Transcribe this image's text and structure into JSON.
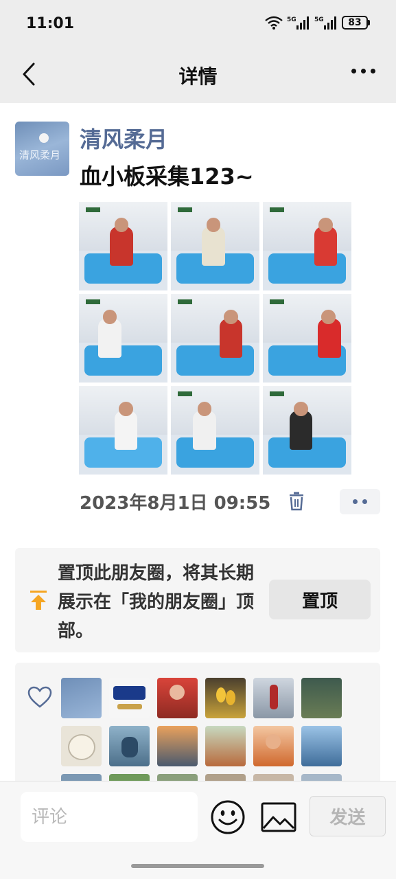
{
  "status_bar": {
    "time": "11:01",
    "signal_1_label": "5G",
    "signal_2_label": "5G",
    "battery": "83",
    "icons": [
      "wifi-icon",
      "signal-icon",
      "signal-icon",
      "battery-icon"
    ]
  },
  "nav": {
    "title": "详情",
    "back_icon": "back-chevron-icon",
    "more_icon": "more-dots-icon"
  },
  "post": {
    "username": "清风柔月",
    "avatar_label": "清风柔月",
    "text": "血小板采集123~",
    "time": "2023年8月1日 09:55",
    "photo_count": 9,
    "delete_icon": "trash-icon",
    "more_icon": "more-dots-icon"
  },
  "pin_card": {
    "text": "置顶此朋友圈，将其长期展示在「我的朋友圈」顶部。",
    "button_label": "置顶",
    "icon": "pin-top-icon"
  },
  "likes": {
    "icon": "heart-icon",
    "visible_rows": 2
  },
  "bottom_bar": {
    "comment_placeholder": "评论",
    "emoji_icon": "emoji-icon",
    "image_icon": "image-icon",
    "send_label": "发送"
  },
  "colors": {
    "username": "#556b95",
    "nav_bg": "#ededed",
    "card_bg": "#f5f5f5",
    "accent_orange": "#f5a623"
  }
}
